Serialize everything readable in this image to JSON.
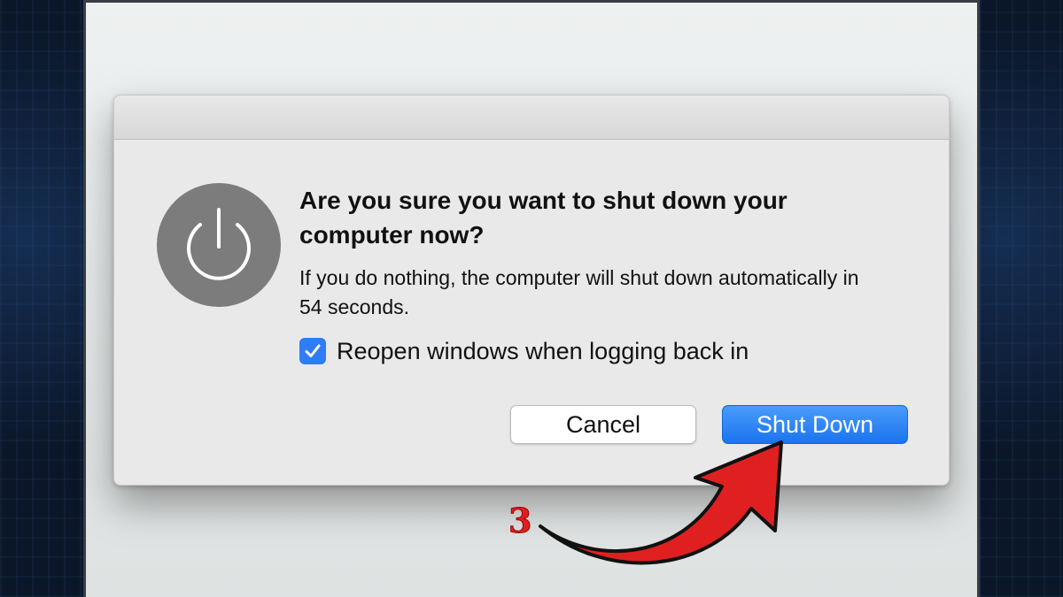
{
  "dialog": {
    "title": "Are you sure you want to shut down your computer now?",
    "message": "If you do nothing, the computer will shut down automatically in 54 seconds.",
    "countdown_seconds": 54,
    "checkbox": {
      "label": "Reopen windows when logging back in",
      "checked": true
    },
    "buttons": {
      "cancel": "Cancel",
      "shut_down": "Shut Down"
    },
    "icon": "power-icon"
  },
  "annotation": {
    "step_number": "3",
    "arrow_color": "#e02020"
  },
  "colors": {
    "accent": "#2e7cf6",
    "icon_bg": "#7c7c7c"
  }
}
